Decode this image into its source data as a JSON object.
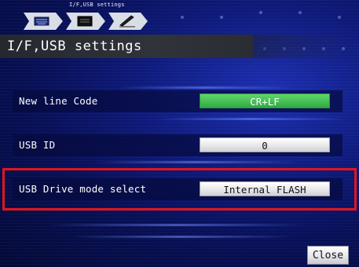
{
  "breadcrumb": {
    "label": "I/F,USB settings",
    "items": [
      {
        "name": "keyboard-icon"
      },
      {
        "name": "screen-icon"
      },
      {
        "name": "pen-icon"
      }
    ]
  },
  "title": "I/F,USB settings",
  "settings": [
    {
      "label": "New line Code",
      "value": "CR+LF",
      "active": true
    },
    {
      "label": "USB ID",
      "value": "0",
      "active": false
    },
    {
      "label": "USB Drive mode select",
      "value": "Internal FLASH",
      "active": false
    }
  ],
  "close_label": "Close",
  "colors": {
    "active_value": "#45c054",
    "highlight": "#e0161e",
    "background": "#0e1a7a"
  }
}
